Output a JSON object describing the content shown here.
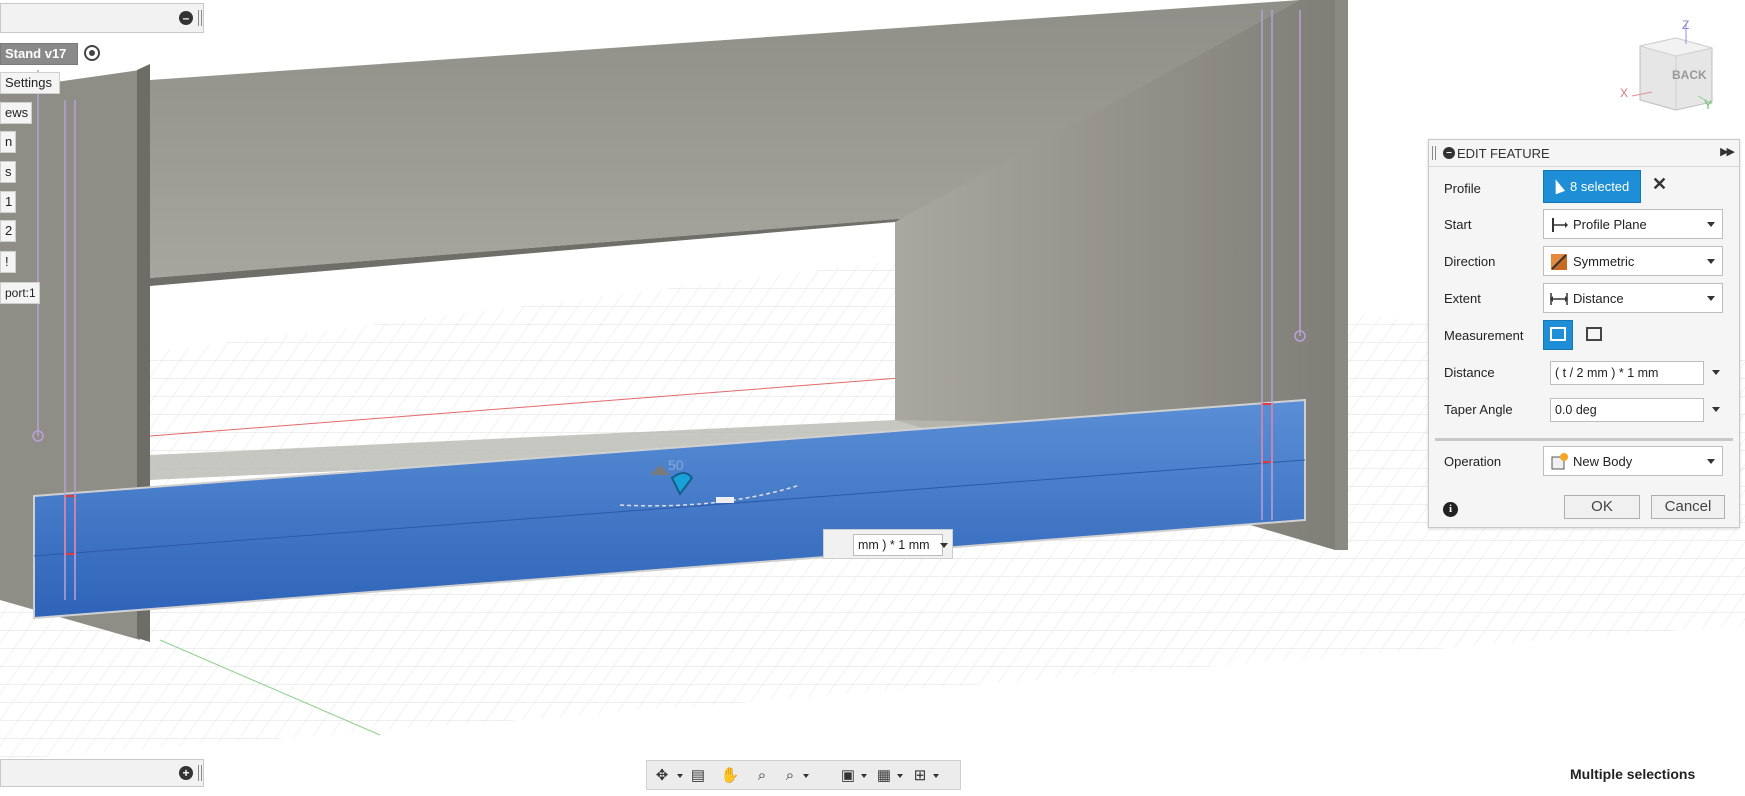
{
  "browser": {
    "root_label": "Stand v17",
    "items": [
      "Settings",
      "ews",
      "n",
      "s",
      "1",
      "2",
      "!",
      "port:1"
    ]
  },
  "viewcube": {
    "face_label": "BACK",
    "axis_z": "Z",
    "axis_x": "X",
    "axis_y": "Y"
  },
  "viewport": {
    "dimension_input_value": "mm ) * 1 mm",
    "manipulator_label": "50"
  },
  "edit_feature": {
    "title": "EDIT FEATURE",
    "rows": {
      "profile": {
        "label": "Profile",
        "value": "8 selected"
      },
      "start": {
        "label": "Start",
        "value": "Profile Plane"
      },
      "direction": {
        "label": "Direction",
        "value": "Symmetric"
      },
      "extent": {
        "label": "Extent",
        "value": "Distance"
      },
      "measurement": {
        "label": "Measurement"
      },
      "distance": {
        "label": "Distance",
        "value": "( t / 2 mm ) * 1 mm"
      },
      "taper_angle": {
        "label": "Taper Angle",
        "value": "0.0 deg"
      },
      "operation": {
        "label": "Operation",
        "value": "New Body"
      }
    },
    "ok_label": "OK",
    "cancel_label": "Cancel"
  },
  "status_bar": {
    "text": "Multiple selections"
  },
  "colors": {
    "accent_blue": "#1e8fd6",
    "selection_blue": "#3f74c4",
    "board_gray": "#9b9b93"
  },
  "icons": [
    "collapse-icon",
    "target-icon",
    "cursor-icon",
    "close-icon",
    "info-icon",
    "orbit-icon",
    "look-at-icon",
    "pan-icon",
    "zoom-icon",
    "fit-icon",
    "display-settings-icon",
    "grid-icon",
    "viewports-icon"
  ]
}
